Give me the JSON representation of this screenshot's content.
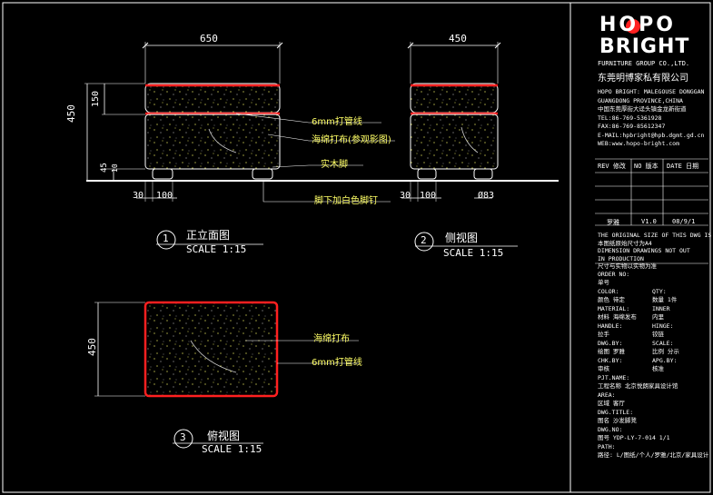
{
  "logo": {
    "hopo": "HOPO",
    "bright": "BRIGHT",
    "group": "FURNITURE GROUP CO.,LTD.",
    "cn_name": "东莞明博家私有限公司"
  },
  "company_info": [
    "HOPO BRIGHT: MALEGOUSE DONGGAN",
    "GUANGDONG PROVINCE,CHINA",
    "中国东莞厚街大迳头镇金龙新街道",
    "TEL:86-769-5361928",
    "FAX:86-769-85612347",
    "E-MAIL:hpbright@hpb.dgmt.gd.cn",
    "WEB:www.hopo-bright.com"
  ],
  "revision_header": {
    "rev": "REV 修改",
    "no": "NO 版本",
    "date": "DATE 日期"
  },
  "revision_row": {
    "name": "罗雅",
    "ver": "V1.0",
    "date": "08/9/1"
  },
  "notes": [
    "THE ORIGINAL SIZE OF THIS DWG IS A4",
    "本图纸原始尺寸为A4",
    "DIMENSION DRAWINGS NOT OUT",
    "IN PRODUCTION",
    "尺寸与实物以实物为准"
  ],
  "title_block": [
    {
      "l1": "ORDER NO:",
      "l2": "单号",
      "r1": "",
      "r2": ""
    },
    {
      "l1": "COLOR:",
      "l2": "颜色    待定",
      "r1": "QTY:",
      "r2": "数量   1件"
    },
    {
      "l1": "MATERIAL:",
      "l2": "材料    海绵发布",
      "r1": "INNER",
      "r2": "内里"
    },
    {
      "l1": "HANDLE:",
      "l2": "拉手",
      "r1": "HINGE:",
      "r2": "铰链"
    },
    {
      "l1": "DWG.BY:",
      "l2": "绘图    罗雅",
      "r1": "SCALE:",
      "r2": "比例   分示"
    },
    {
      "l1": "CHK.BY:",
      "l2": "审核",
      "r1": "APG.BY:",
      "r2": "核准"
    },
    {
      "l1": "PJT.NAME:",
      "l2": "工程名称     北京悦朗家具设计馆",
      "r1": "",
      "r2": ""
    },
    {
      "l1": "AREA:",
      "l2": "区域          客厅",
      "r1": "",
      "r2": ""
    },
    {
      "l1": "DWG.TITLE:",
      "l2": "图名          沙发脚凳",
      "r1": "",
      "r2": ""
    },
    {
      "l1": "DWG.NO:",
      "l2": "图号     YDP-LY-7-014     1/1",
      "r1": "",
      "r2": ""
    },
    {
      "l1": "PATH:",
      "l2": "路径: L/图纸/个人/罗雅/北京/家具设计",
      "r1": "",
      "r2": ""
    }
  ],
  "front_view": {
    "title": "正立面图",
    "number": "1",
    "scale": "SCALE 1:15",
    "dims": {
      "width": "650",
      "height": "450",
      "cushion": "150",
      "leg1": "45",
      "leg2": "10",
      "foot_a": "30",
      "foot_b": "100"
    }
  },
  "side_view": {
    "title": "侧视图",
    "number": "2",
    "scale": "SCALE 1:15",
    "dims": {
      "width": "450",
      "foot_a": "30",
      "foot_b": "100",
      "dia": "Ø83"
    }
  },
  "top_view": {
    "title": "俯视图",
    "number": "3",
    "scale": "SCALE 1:15",
    "dims": {
      "depth": "450"
    }
  },
  "labels": {
    "piping": "6mm打管线",
    "fabric": "海绵打布(参观影图)",
    "legs": "实木脚",
    "glides": "脚下加白色脚钉",
    "top_fabric": "海绵打布",
    "top_piping": "6mm打管线"
  },
  "colors": {
    "line": "#ffffff",
    "accent": "#ff2020",
    "cyan": "#00e5ff",
    "dot": "#ffff66",
    "label": "#ffff66"
  }
}
